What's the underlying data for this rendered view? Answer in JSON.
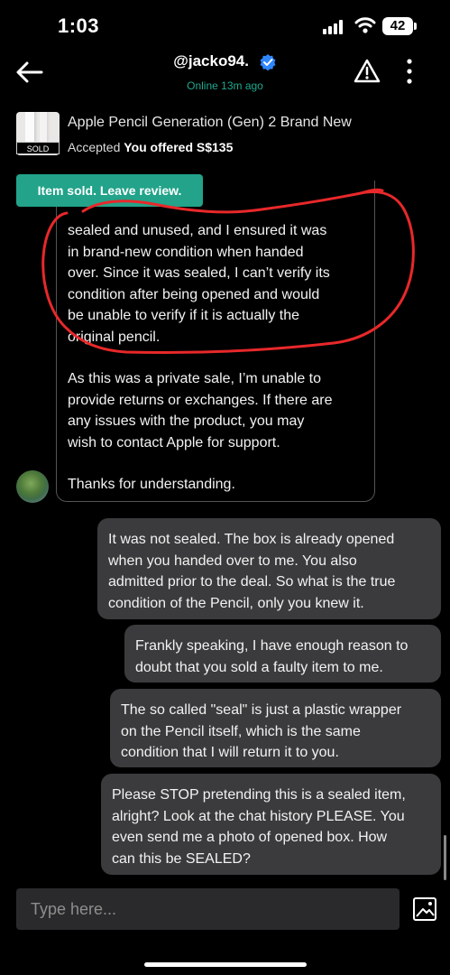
{
  "status_bar": {
    "time": "1:03",
    "battery": "42"
  },
  "header": {
    "username": "@jacko94.",
    "online_status": "Online 13m ago"
  },
  "listing": {
    "title": "Apple Pencil Generation (Gen) 2 Brand New",
    "status_prefix": "Accepted",
    "status_offer": "You offered S$135",
    "sold_tag": "SOLD"
  },
  "review_button": "Item sold. Leave review.",
  "incoming_message": {
    "lines": [
      "sealed and unused, and I ensured it was",
      "in brand-new condition when handed",
      "over. Since it was sealed, I can’t verify its",
      "condition after being opened and would",
      "be unable to verify if it is actually the",
      "original pencil.",
      "As this was a private sale, I’m unable to",
      "provide returns or exchanges. If there are",
      "any issues with the product, you may",
      "wish to contact Apple for support.",
      "Thanks for understanding."
    ]
  },
  "outgoing_messages": [
    {
      "lines": [
        "It was not sealed. The box is already opened",
        "when you handed over to me. You also",
        "admitted prior to the deal. So what is the true",
        "condition of the Pencil, only you knew it."
      ]
    },
    {
      "lines": [
        "Frankly speaking, I have enough reason to",
        "doubt that you sold a faulty item to me."
      ]
    },
    {
      "lines": [
        "The so called \"seal\" is just a plastic wrapper",
        "on the Pencil itself, which is the same",
        "condition that I will return it to you."
      ]
    },
    {
      "lines": [
        "Please STOP pretending this is a sealed item,",
        "alright? Look at the chat history PLEASE. You",
        "even send me a photo of opened box. How",
        "can this be SEALED?"
      ]
    }
  ],
  "composer": {
    "placeholder": "Type here..."
  },
  "colors": {
    "accent": "#22a38a",
    "online": "#1fa88e",
    "annotation": "#e8282a",
    "bubble_out": "#3b3b3d"
  }
}
